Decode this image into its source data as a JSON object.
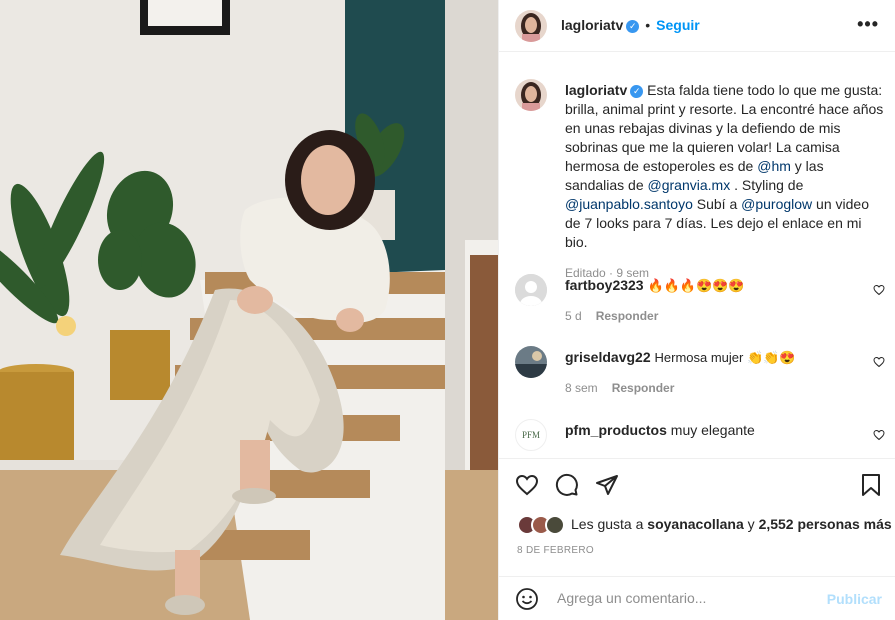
{
  "post_image": {
    "alt": "Mujer sentada en escaleras con falda de lentejuelas"
  },
  "header": {
    "username": "lagloriatv",
    "separator": "•",
    "follow_label": "Seguir",
    "more_label": "•••"
  },
  "caption": {
    "username": "lagloriatv",
    "text_1": " Esta falda tiene todo lo que me gusta: brilla, animal print y resorte. La encontré hace años en unas rebajas divinas y la defiendo de mis sobrinas que me la quieren volar! La camisa hermosa de estoperoles es de ",
    "mention_1": "@hm",
    "text_2": " y las sandalias de ",
    "mention_2": "@granvia.mx",
    "text_3": " . Styling de ",
    "mention_3": "@juanpablo.santoyo",
    "text_4": " Subí a ",
    "mention_4": "@puroglow",
    "text_5": " un video de 7 looks para 7 días. Les dejo el enlace en mi bio.",
    "meta": "Editado · 9 sem"
  },
  "comments": [
    {
      "username": "fartboy2323",
      "text": "🔥🔥🔥😍😍😍",
      "age": "5 d",
      "reply": "Responder"
    },
    {
      "username": "griseldavg22",
      "text": "Hermosa mujer 👏👏😍",
      "age": "8 sem",
      "reply": "Responder"
    },
    {
      "username": "pfm_productos",
      "text": "muy elegante",
      "avatar_text": "PFM"
    }
  ],
  "likes": {
    "prefix": "Les gusta a ",
    "user": "soyanacollana",
    "middle": " y ",
    "count": "2,552 personas más"
  },
  "date": "8 DE FEBRERO",
  "add_comment": {
    "placeholder": "Agrega un comentario...",
    "publish_label": "Publicar"
  },
  "colors": {
    "link_blue": "#0095f6",
    "mention": "#00376b",
    "publish_disabled": "#b2dffc"
  }
}
